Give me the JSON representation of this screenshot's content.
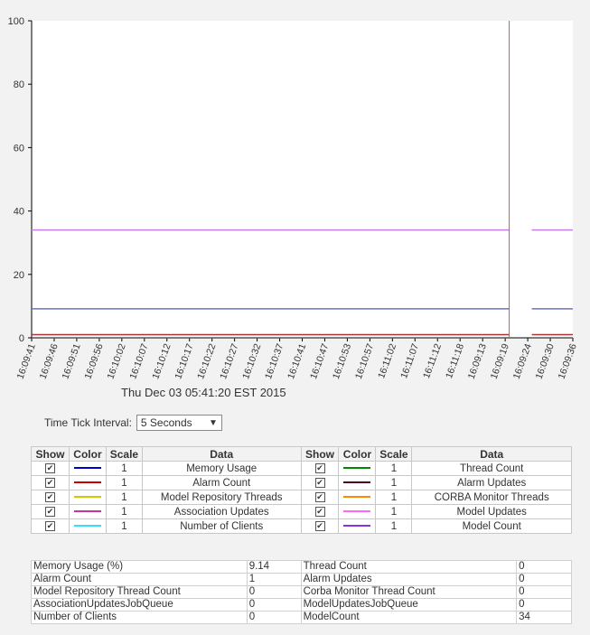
{
  "chart_data": {
    "type": "line",
    "y_ticks": [
      "0",
      "20",
      "40",
      "60",
      "80",
      "100"
    ],
    "ylim": [
      0,
      100
    ],
    "x_ticks": [
      "16:09:41",
      "16:09:46",
      "16:09:51",
      "16:09:56",
      "16:10:02",
      "16:10:07",
      "16:10:12",
      "16:10:17",
      "16:10:22",
      "16:10:27",
      "16:10:32",
      "16:10:37",
      "16:10:41",
      "16:10:47",
      "16:10:53",
      "16:10:57",
      "16:11:02",
      "16:11:07",
      "16:11:12",
      "16:11:18",
      "16:09:13",
      "16:09:19",
      "16:09:24",
      "16:09:30",
      "16:09:36"
    ],
    "marker_after_tick": 21,
    "series": [
      {
        "name": "Model Count",
        "color": "#c57fe6",
        "value": 34
      },
      {
        "name": "Memory Usage",
        "color": "#6c70c8",
        "value": 9.14
      },
      {
        "name": "Alarm Count",
        "color": "#a33",
        "value": 1
      },
      {
        "name": "Alarm Updates",
        "color": "#555",
        "value": 0
      }
    ],
    "marker_color": "#d9534f"
  },
  "date_label": "Thu Dec 03 05:41:20 EST 2015",
  "interval": {
    "label": "Time Tick Interval:",
    "value": "5 Seconds"
  },
  "legend": {
    "headers": [
      "Show",
      "Color",
      "Scale",
      "Data",
      "Show",
      "Color",
      "Scale",
      "Data"
    ],
    "rows": [
      {
        "left": {
          "color": "#0000cc",
          "scale": "1",
          "name": "Memory Usage"
        },
        "right": {
          "color": "#008800",
          "scale": "1",
          "name": "Thread Count"
        }
      },
      {
        "left": {
          "color": "#cc0000",
          "scale": "1",
          "name": "Alarm Count"
        },
        "right": {
          "color": "#550022",
          "scale": "1",
          "name": "Alarm Updates"
        }
      },
      {
        "left": {
          "color": "#cccc00",
          "scale": "1",
          "name": "Model Repository Threads"
        },
        "right": {
          "color": "#ff8800",
          "scale": "1",
          "name": "CORBA Monitor Threads"
        }
      },
      {
        "left": {
          "color": "#cc3399",
          "scale": "1",
          "name": "Association Updates"
        },
        "right": {
          "color": "#ff66ff",
          "scale": "1",
          "name": "Model Updates"
        }
      },
      {
        "left": {
          "color": "#33ddff",
          "scale": "1",
          "name": "Number of Clients"
        },
        "right": {
          "color": "#8833dd",
          "scale": "1",
          "name": "Model Count"
        }
      }
    ]
  },
  "stats": [
    [
      "Memory Usage (%)",
      "9.14",
      "Thread Count",
      "0"
    ],
    [
      "Alarm Count",
      "1",
      "Alarm Updates",
      "0"
    ],
    [
      "Model Repository Thread Count",
      "0",
      "Corba Monitor Thread Count",
      "0"
    ],
    [
      "AssociationUpdatesJobQueue",
      "0",
      "ModelUpdatesJobQueue",
      "0"
    ],
    [
      "Number of Clients",
      "0",
      "ModelCount",
      "34"
    ]
  ]
}
